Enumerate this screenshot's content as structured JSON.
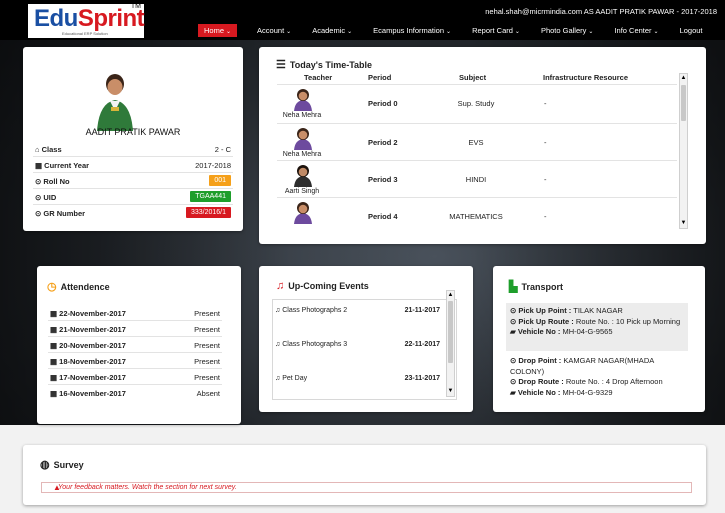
{
  "brand": {
    "name_part1": "Edu",
    "name_part2": "Sprint",
    "tm": "TM",
    "tagline": "Educational ERP Solution"
  },
  "header": {
    "user_line": "nehal.shah@micrmindia.com AS AADIT PRATIK PAWAR - 2017-2018"
  },
  "nav": [
    {
      "label": "Home",
      "caret": "⌄"
    },
    {
      "label": "Account",
      "caret": "⌄"
    },
    {
      "label": "Academic",
      "caret": "⌄"
    },
    {
      "label": "Ecampus Information",
      "caret": "⌄"
    },
    {
      "label": "Report Card",
      "caret": "⌄"
    },
    {
      "label": "Photo Gallery",
      "caret": "⌄"
    },
    {
      "label": "Info Center",
      "caret": "⌄"
    },
    {
      "label": "Logout",
      "caret": ""
    }
  ],
  "profile": {
    "name": "AADIT PRATIK PAWAR",
    "rows": [
      {
        "label": "Class",
        "icon": "home-icon",
        "value": "2 - C"
      },
      {
        "label": "Current Year",
        "icon": "calendar-icon",
        "value": "2017-2018"
      },
      {
        "label": "Roll No",
        "icon": "circle-dot-icon",
        "value": "001",
        "badge_color": "#f5a01a"
      },
      {
        "label": "UID",
        "icon": "circle-dot-icon",
        "value": "TGAA441",
        "badge_color": "#1e9e2b"
      },
      {
        "label": "GR Number",
        "icon": "circle-dot-icon",
        "value": "333/2016/1",
        "badge_color": "#d71920"
      }
    ]
  },
  "timetable": {
    "title": "Today's Time-Table",
    "headers": {
      "teacher": "Teacher",
      "period": "Period",
      "subject": "Subject",
      "infra": "Infrastructure Resource"
    },
    "rows": [
      {
        "teacher": "Neha Mehra",
        "period": "Period 0",
        "subject": "Sup. Study",
        "infra": "-"
      },
      {
        "teacher": "Neha Mehra",
        "period": "Period 2",
        "subject": "EVS",
        "infra": "-"
      },
      {
        "teacher": "Aarti Singh",
        "period": "Period 3",
        "subject": "HINDI",
        "infra": "-"
      },
      {
        "teacher": "",
        "period": "Period 4",
        "subject": "MATHEMATICS",
        "infra": "-"
      }
    ]
  },
  "attendance": {
    "title": "Attendence",
    "rows": [
      {
        "date": "22-November-2017",
        "status": "Present"
      },
      {
        "date": "21-November-2017",
        "status": "Present"
      },
      {
        "date": "20-November-2017",
        "status": "Present"
      },
      {
        "date": "18-November-2017",
        "status": "Present"
      },
      {
        "date": "17-November-2017",
        "status": "Present"
      },
      {
        "date": "16-November-2017",
        "status": "Absent"
      }
    ]
  },
  "events": {
    "title": "Up-Coming Events",
    "rows": [
      {
        "name": "Class Photographs 2",
        "date": "21-11-2017"
      },
      {
        "name": "Class Photographs 3",
        "date": "22-11-2017"
      },
      {
        "name": "Pet Day",
        "date": "23-11-2017"
      }
    ]
  },
  "transport": {
    "title": "Transport",
    "pickup": {
      "point_label": "Pick Up Point :",
      "point": "TILAK NAGAR",
      "route_label": "Pick Up Route :",
      "route": "Route No. : 10 Pick up Morning",
      "vehicle_label": "Vehicle No :",
      "vehicle": "MH-04-G-9565"
    },
    "drop": {
      "point_label": "Drop Point :",
      "point": "KAMGAR NAGAR(MHADA COLONY)",
      "route_label": "Drop Route :",
      "route": "Route No. : 4 Drop Afternoon",
      "vehicle_label": "Vehicle No :",
      "vehicle": "MH-04-G-9329"
    }
  },
  "survey": {
    "title": "Survey",
    "message": "Your feedback matters. Watch the section for next survey."
  },
  "colors": {
    "brand_red": "#d71920",
    "brand_blue": "#1a4fa3",
    "header_bg": "#000000"
  }
}
